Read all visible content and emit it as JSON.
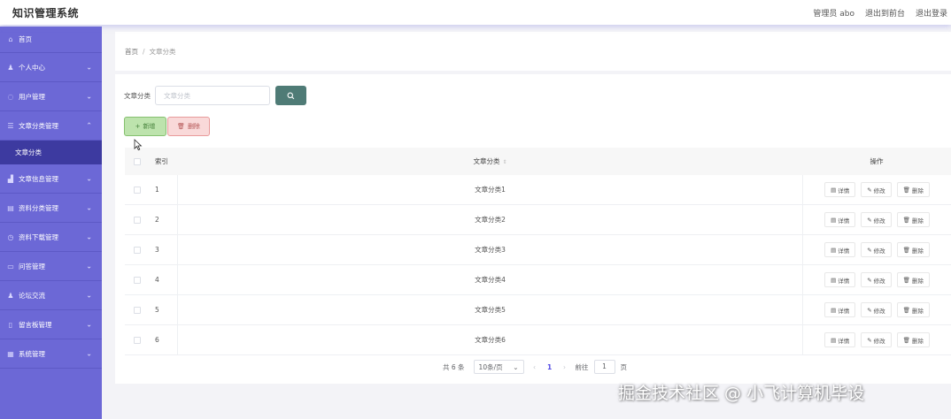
{
  "app": {
    "title": "知识管理系统"
  },
  "topbar": {
    "user": "管理员 abo",
    "to_front": "退出到前台",
    "logout": "退出登录"
  },
  "sidebar": {
    "home": "首页",
    "items": [
      {
        "label": "个人中心",
        "icon": "user-icon"
      },
      {
        "label": "用户管理",
        "icon": "shield-icon"
      },
      {
        "label": "文章分类管理",
        "icon": "list-icon",
        "expanded": true
      },
      {
        "label": "文章信息管理",
        "icon": "chart-icon"
      },
      {
        "label": "资料分类管理",
        "icon": "folder-icon"
      },
      {
        "label": "资料下载管理",
        "icon": "clock-icon"
      },
      {
        "label": "问答管理",
        "icon": "chat-icon"
      },
      {
        "label": "论坛交流",
        "icon": "people-icon"
      },
      {
        "label": "留言板管理",
        "icon": "note-icon"
      },
      {
        "label": "系统管理",
        "icon": "gear-icon"
      }
    ],
    "subitem": "文章分类"
  },
  "breadcrumb": {
    "home": "首页",
    "separator": "/",
    "current": "文章分类"
  },
  "search": {
    "label": "文章分类",
    "placeholder": "文章分类",
    "value": ""
  },
  "actions": {
    "add": "新增",
    "delete": "删除"
  },
  "table": {
    "headers": {
      "index": "索引",
      "name": "文章分类",
      "ops": "操作"
    },
    "rows": [
      {
        "index": "1",
        "name": "文章分类1"
      },
      {
        "index": "2",
        "name": "文章分类2"
      },
      {
        "index": "3",
        "name": "文章分类3"
      },
      {
        "index": "4",
        "name": "文章分类4"
      },
      {
        "index": "5",
        "name": "文章分类5"
      },
      {
        "index": "6",
        "name": "文章分类6"
      }
    ],
    "row_ops": {
      "detail": "详情",
      "edit": "修改",
      "delete": "删除"
    }
  },
  "pagination": {
    "total": "共 6 条",
    "page_size": "10条/页",
    "current_page": "1",
    "goto_label": "前往",
    "goto_value": "1",
    "page_suffix": "页"
  },
  "watermark": "掘金技术社区 @ 小飞计算机毕设",
  "colors": {
    "sidebar": "#6c68d6",
    "search_button": "#4f7b76",
    "active_submenu": "#3d3aa0"
  }
}
